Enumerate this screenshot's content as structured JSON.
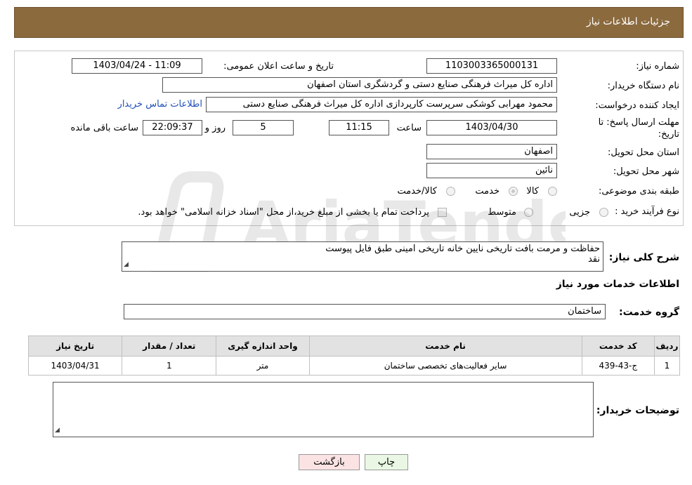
{
  "header": {
    "title": "جزئیات اطلاعات نیاز"
  },
  "form": {
    "need_number_label": "شماره نیاز:",
    "need_number": "1103003365000131",
    "announce_label": "تاریخ و ساعت اعلان عمومی:",
    "announce_value": "1403/04/24 - 11:09",
    "buyer_org_label": "نام دستگاه خریدار:",
    "buyer_org": "اداره کل میراث فرهنگی  صنایع دستی و گردشگری استان اصفهان",
    "creator_label": "ایجاد کننده درخواست:",
    "creator": "محمود مهرابی کوشکی سرپرست کارپردازی اداره کل میراث فرهنگی  صنایع دستی",
    "contact_link": "اطلاعات تماس خریدار",
    "deadline_label_1": "مهلت ارسال پاسخ: تا",
    "deadline_label_2": "تاریخ:",
    "deadline_date": "1403/04/30",
    "time_label": "ساعت",
    "deadline_time": "11:15",
    "days_value": "5",
    "days_label": "روز و",
    "remaining_time": "22:09:37",
    "remaining_label": "ساعت باقی مانده",
    "province_label": "استان محل تحویل:",
    "province": "اصفهان",
    "city_label": "شهر محل تحویل:",
    "city": "نائین",
    "category_label": "طبقه بندی موضوعی:",
    "category_options": [
      "کالا",
      "خدمت",
      "کالا/خدمت"
    ],
    "category_selected": "خدمت",
    "purchase_type_label": "نوع فرآیند خرید :",
    "purchase_options": [
      "جزیی",
      "متوسط"
    ],
    "purchase_note": "پرداخت تمام یا بخشی از مبلغ خرید،از محل \"اسناد خزانه اسلامی\" خواهد بود."
  },
  "description": {
    "label": "شرح کلی نیاز:",
    "line1": "حفاظت و مرمت بافت تاریخی نایین خانه تاریخی امینی طبق فایل پیوست",
    "line2": "نقد"
  },
  "services": {
    "section_title": "اطلاعات خدمات مورد نیاز",
    "group_label": "گروه خدمت:",
    "group_value": "ساختمان",
    "columns": [
      "ردیف",
      "کد خدمت",
      "نام خدمت",
      "واحد اندازه گیری",
      "تعداد / مقدار",
      "تاریخ نیاز"
    ],
    "rows": [
      [
        "1",
        "ج-43-439",
        "سایر فعالیت‌های تخصصی ساختمان",
        "متر",
        "1",
        "1403/04/31"
      ]
    ]
  },
  "buyer_notes": {
    "label": "توضیحات خریدار:",
    "value": ""
  },
  "buttons": {
    "print": "چاپ",
    "back": "بازگشت"
  },
  "watermark": {
    "text": "AriaTender.neT"
  },
  "colors": {
    "header_bg": "#8b6a3e",
    "back_button_bg": "#fbe3e3",
    "print_button_bg": "#eaf7e4",
    "link": "#1f4fb8"
  }
}
